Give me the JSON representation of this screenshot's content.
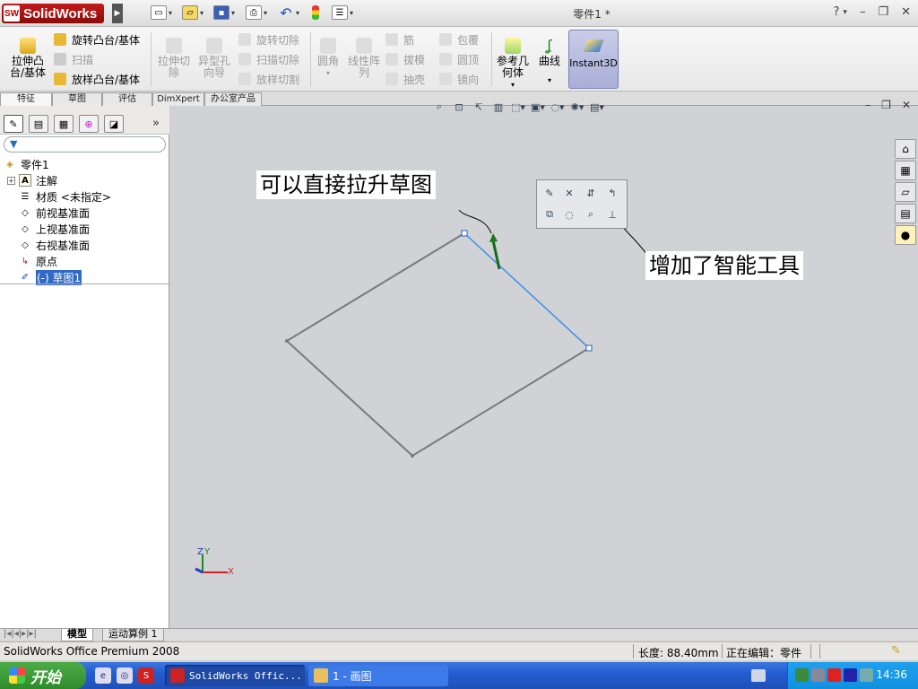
{
  "app": {
    "logo_mark": "SW",
    "name": "SolidWorks",
    "document_title": "零件1 *",
    "help": "?"
  },
  "ribbon": {
    "extrude_boss": "拉伸凸\n台/基体",
    "revolve_boss": "旋转凸台/基体",
    "sweep": "扫描",
    "loft_boss": "放样凸台/基体",
    "extrude_cut": "拉伸切\n除",
    "hole_wizard": "异型孔\n向导",
    "revolve_cut": "旋转切除",
    "sweep_cut": "扫描切除",
    "loft_cut": "放样切割",
    "fillet": "圆角",
    "linear_pattern": "线性阵\n列",
    "rib": "筋",
    "draft": "拔模",
    "shell": "抽壳",
    "wrap": "包覆",
    "dome": "圆顶",
    "mirror": "镜向",
    "ref_geometry": "参考几\n何体",
    "curves": "曲线",
    "instant3d": "Instant3D"
  },
  "command_tabs": [
    "特征",
    "草图",
    "评估",
    "DimXpert",
    "办公室产品"
  ],
  "feature_tree": {
    "root": "零件1",
    "items": [
      {
        "label": "注解",
        "icon": "annotation-icon"
      },
      {
        "label": "材质 <未指定>",
        "icon": "material-icon"
      },
      {
        "label": "前视基准面",
        "icon": "plane-icon"
      },
      {
        "label": "上视基准面",
        "icon": "plane-icon"
      },
      {
        "label": "右视基准面",
        "icon": "plane-icon"
      },
      {
        "label": "原点",
        "icon": "origin-icon"
      },
      {
        "label": "(-) 草图1",
        "icon": "sketch-icon"
      }
    ]
  },
  "graphics": {
    "callout_1": "可以直接拉升草图",
    "callout_2": "增加了智能工具",
    "triad_labels": {
      "z": "Z",
      "y": "Y",
      "x": "X"
    }
  },
  "bottom_tabs": [
    "模型",
    "运动算例 1"
  ],
  "status": {
    "product": "SolidWorks Office Premium 2008",
    "length": "长度: 88.40mm",
    "mode": "正在编辑：零件"
  },
  "taskbar": {
    "start": "开始",
    "solidworks_button": "SolidWorks Offic...",
    "paint_button": "1 - 画图",
    "clock": "14:36"
  }
}
